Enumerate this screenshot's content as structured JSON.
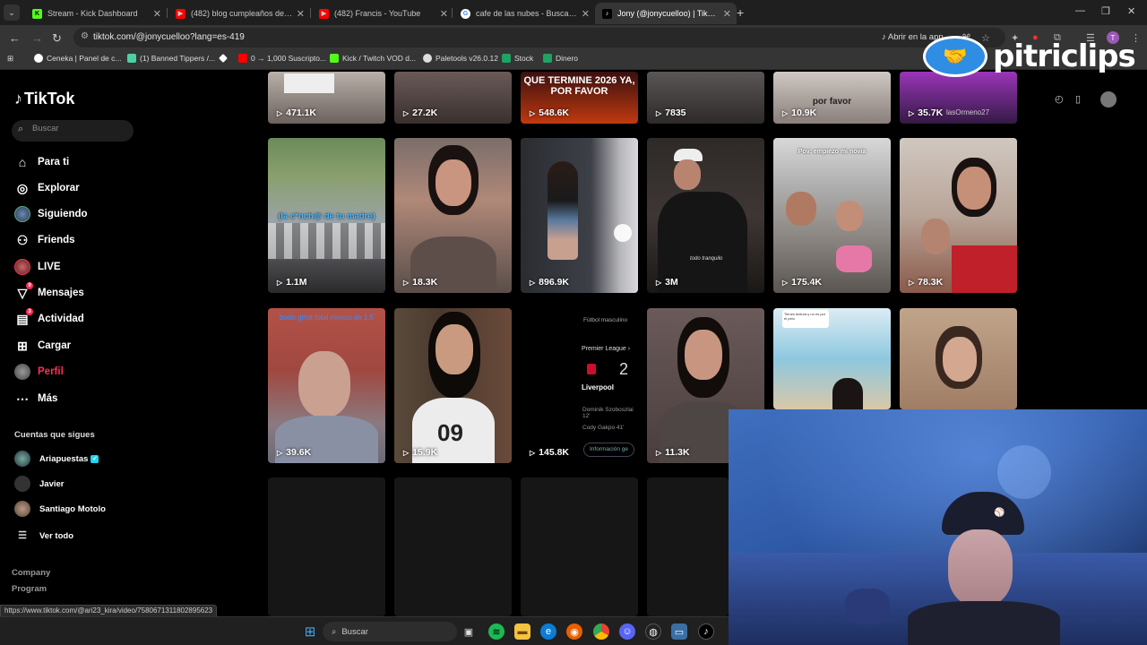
{
  "browser": {
    "tabs": [
      {
        "title": "Stream - Kick Dashboard",
        "fav_color": "#53fc18",
        "fav_glyph": "K"
      },
      {
        "title": "(482) blog cumpleaños de Ciro",
        "fav_color": "#ff0000",
        "fav_glyph": "▶"
      },
      {
        "title": "(482) Francis - YouTube",
        "fav_color": "#ff0000",
        "fav_glyph": "▶"
      },
      {
        "title": "cafe de las nubes - Buscar con",
        "fav_color": "#ffffff",
        "fav_glyph": "G"
      },
      {
        "title": "Jony (@jonycuelloo) | TikTok",
        "fav_color": "#000000",
        "fav_glyph": "♪"
      }
    ],
    "url": "tiktok.com/@jonycuelloo?lang=es-419",
    "open_in_app": "Abrir en la app",
    "bookmarks": [
      {
        "label": "Ceneka | Panel de c...",
        "color": "#ffffff"
      },
      {
        "label": "(1) Banned Tippers /...",
        "color": "#4dd0a0"
      },
      {
        "label": "",
        "color": "#ffffff"
      },
      {
        "label": "0 → 1,000 Suscripto...",
        "color": "#ff0000"
      },
      {
        "label": "Kick / Twitch VOD d...",
        "color": "#53fc18"
      },
      {
        "label": "Paletools v26.0.12",
        "color": "#dddddd"
      },
      {
        "label": "Stock",
        "color": "#1ea362"
      },
      {
        "label": "Dinero",
        "color": "#1ea362"
      }
    ],
    "status_url": "https://www.tiktok.com/@ari23_kira/video/7580671311802895623"
  },
  "tiktok": {
    "logo": "TikTok",
    "search_placeholder": "Buscar",
    "nav": [
      {
        "label": "Para ti",
        "icon": "home-icon",
        "glyph": "⌂"
      },
      {
        "label": "Explorar",
        "icon": "compass-icon",
        "glyph": "◎"
      },
      {
        "label": "Siguiendo",
        "icon": "following-avatar",
        "glyph": ""
      },
      {
        "label": "Friends",
        "icon": "friends-icon",
        "glyph": "👥"
      },
      {
        "label": "LIVE",
        "icon": "live-avatar",
        "glyph": ""
      },
      {
        "label": "Mensajes",
        "icon": "messages-icon",
        "glyph": "▽",
        "badge": "9"
      },
      {
        "label": "Actividad",
        "icon": "activity-icon",
        "glyph": "▤",
        "badge": "3"
      },
      {
        "label": "Cargar",
        "icon": "upload-icon",
        "glyph": "⊞"
      },
      {
        "label": "Perfil",
        "icon": "profile-avatar",
        "glyph": ""
      },
      {
        "label": "Más",
        "icon": "more-icon",
        "glyph": "⋯"
      }
    ],
    "following_title": "Cuentas que sigues",
    "following": [
      {
        "name": "Ariapuestas",
        "verified": true
      },
      {
        "name": "Javier",
        "verified": false
      },
      {
        "name": "Santiago Motolo",
        "verified": false
      }
    ],
    "see_all": "Ver todo",
    "footer": [
      "Company",
      "Program"
    ],
    "videos_row0": [
      "471.1K",
      "27.2K",
      "548.6K",
      "7835",
      "10.9K",
      "35.7K"
    ],
    "videos_row1": [
      "1.1M",
      "18.3K",
      "896.9K",
      "3M",
      "175.4K",
      "78.3K"
    ],
    "videos_row2": [
      "39.6K",
      "15.9K",
      "145.8K",
      "11.3K",
      "",
      ""
    ],
    "captions": {
      "top3": "QUE TERMINE 2026 YA, POR FAVOR",
      "top5": "por favor",
      "top6": "lasOrmeno27",
      "r1c1": "(la c*nch@ de tu madre)",
      "r1c5": "Pov: empiezo mi novia",
      "r1c4": "todo tranquilo",
      "r2c1": "bodo glmit total menos de 1.5",
      "r2c3_league": "Premier League ›",
      "r2c3_title": "Fútbol masculino",
      "r2c3_score": "2",
      "r2c3_team": "Liverpool",
      "r2c3_scorer1": "Dominik Szoboszlai 12'",
      "r2c3_scorer2": "Cody Gakpo 41'",
      "r2c3_info": "Información ge",
      "r2c2_jersey": "09",
      "r2c5_note": "Tienes textura y no es por el pelo"
    }
  },
  "overlay": {
    "watermark": "pitriclips"
  },
  "taskbar": {
    "search": "Buscar"
  }
}
